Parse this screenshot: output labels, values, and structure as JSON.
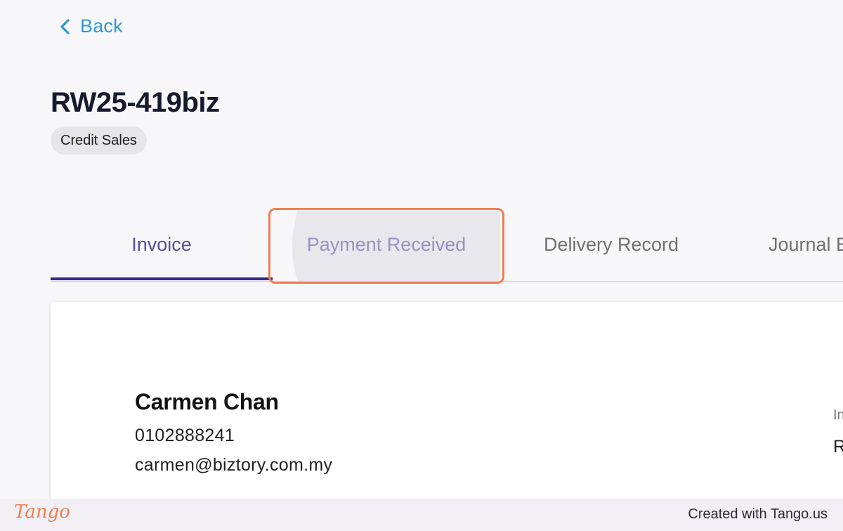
{
  "back": {
    "label": "Back",
    "icon": "chevron-left-icon"
  },
  "document": {
    "number": "RW25-419biz",
    "type_badge": "Credit Sales"
  },
  "tabs": [
    {
      "label": "Invoice",
      "active": true
    },
    {
      "label": "Payment Received",
      "active": false,
      "highlighted": true
    },
    {
      "label": "Delivery Record",
      "active": false
    },
    {
      "label": "Journal E",
      "active": false
    }
  ],
  "customer": {
    "name": "Carmen Chan",
    "phone": "0102888241",
    "email": "carmen@biztory.com.my"
  },
  "invoice_meta_fragment": {
    "label_fragment": "In",
    "value_fragment": "R"
  },
  "footer": {
    "logo_text": "Tango",
    "credit": "Created with Tango.us"
  },
  "colors": {
    "link": "#2d9ad6",
    "active_tab_text": "#5b4ba0",
    "active_tab_underline": "#3a268f",
    "highlight_border": "#ef7f52",
    "background": "#f7f7f9"
  }
}
